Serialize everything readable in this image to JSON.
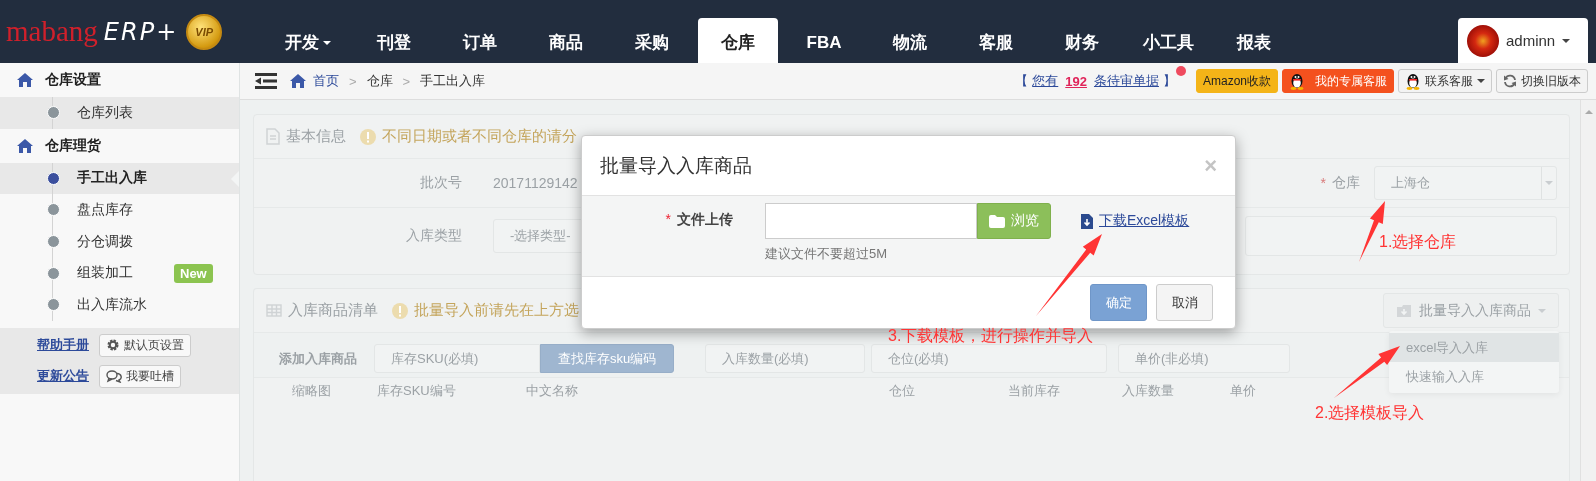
{
  "logo": {
    "brand": "mabang",
    "product": "ERP+",
    "badge": "VIP"
  },
  "nav_tabs": [
    {
      "label": "开发",
      "dropdown": true,
      "selected": false
    },
    {
      "label": "刊登",
      "dropdown": false,
      "selected": false
    },
    {
      "label": "订单",
      "dropdown": false,
      "selected": false
    },
    {
      "label": "商品",
      "dropdown": false,
      "selected": false
    },
    {
      "label": "采购",
      "dropdown": false,
      "selected": false
    },
    {
      "label": "仓库",
      "dropdown": false,
      "selected": true
    },
    {
      "label": "FBA",
      "dropdown": false,
      "selected": false
    },
    {
      "label": "物流",
      "dropdown": false,
      "selected": false
    },
    {
      "label": "客服",
      "dropdown": false,
      "selected": false
    },
    {
      "label": "财务",
      "dropdown": false,
      "selected": false
    },
    {
      "label": "小工具",
      "dropdown": false,
      "selected": false
    },
    {
      "label": "报表",
      "dropdown": false,
      "selected": false
    }
  ],
  "user": {
    "name": "adminn"
  },
  "sidebar": {
    "groups": [
      {
        "title": "仓库设置",
        "items": [
          {
            "label": "仓库列表",
            "selected": false,
            "hovered": true
          }
        ]
      },
      {
        "title": "仓库理货",
        "items": [
          {
            "label": "手工出入库",
            "selected": true,
            "hovered": false
          },
          {
            "label": "盘点库存",
            "selected": false,
            "hovered": false
          },
          {
            "label": "分仓调拨",
            "selected": false,
            "hovered": false
          },
          {
            "label": "组装加工",
            "selected": false,
            "hovered": false,
            "badge": "New"
          },
          {
            "label": "出入库流水",
            "selected": false,
            "hovered": false
          }
        ]
      }
    ],
    "links": [
      {
        "link": "帮助手册",
        "button": "默认页设置",
        "kind": "settings"
      },
      {
        "link": "更新公告",
        "button": "我要吐槽",
        "kind": "feedback"
      }
    ]
  },
  "breadcrumb": [
    {
      "label": "首页"
    },
    {
      "separator": ">",
      "label": "仓库"
    },
    {
      "separator": ">",
      "label": "手工出入库"
    }
  ],
  "notice": {
    "open": "【",
    "prefix": "您有",
    "count": "192",
    "suffix": "条待审单据",
    "close": "】",
    "dot": true
  },
  "header_buttons": [
    {
      "label": "Amazon收款",
      "kind": "amazon",
      "dropdown": false
    },
    {
      "label": "我的专属客服",
      "kind": "service",
      "dropdown": false
    },
    {
      "label": "联系客服",
      "kind": "contact",
      "dropdown": true
    },
    {
      "label": "切换旧版本",
      "kind": "switch",
      "dropdown": false
    }
  ],
  "basic_info": {
    "title": "基本信息",
    "warning": "不同日期或者不同仓库的请分",
    "batch_label": "批次号",
    "batch_value": "20171129142",
    "type_label": "入库类型",
    "type_value": "-选择类型-",
    "warehouse_mark": "*",
    "warehouse_label": "仓库",
    "warehouse_value": "上海仓"
  },
  "products": {
    "title": "入库商品清单",
    "warning": "批量导入前请先在上方选",
    "import_button": "批量导入入库商品",
    "import_menu": [
      {
        "label": "excel导入入库",
        "hovered": true
      },
      {
        "label": "快速输入入库",
        "hovered": false
      }
    ],
    "add_label": "添加入库商品",
    "sku_placeholder": "库存SKU(必填)",
    "find_button": "查找库存sku编码",
    "qty_placeholder": "入库数量(必填)",
    "bin_placeholder": "仓位(必填)",
    "price_placeholder": "单价(非必填)",
    "columns": [
      "缩略图",
      "库存SKU编号",
      "中文名称",
      "仓位",
      "当前库存",
      "入库数量",
      "单价"
    ]
  },
  "modal": {
    "title": "批量导入入库商品",
    "close": "×",
    "required_mark": "*",
    "upload_label": "文件上传",
    "browse": "浏览",
    "template_link": "下载Excel模板",
    "hint": "建议文件不要超过5M",
    "buttons": [
      {
        "label": "确定",
        "kind": "primary"
      },
      {
        "label": "取消",
        "kind": "default"
      }
    ]
  },
  "annotations": [
    {
      "text": "1.选择仓库"
    },
    {
      "text": "2.选择模板导入"
    },
    {
      "text": "3.下载模板，进行操作并导入"
    }
  ]
}
